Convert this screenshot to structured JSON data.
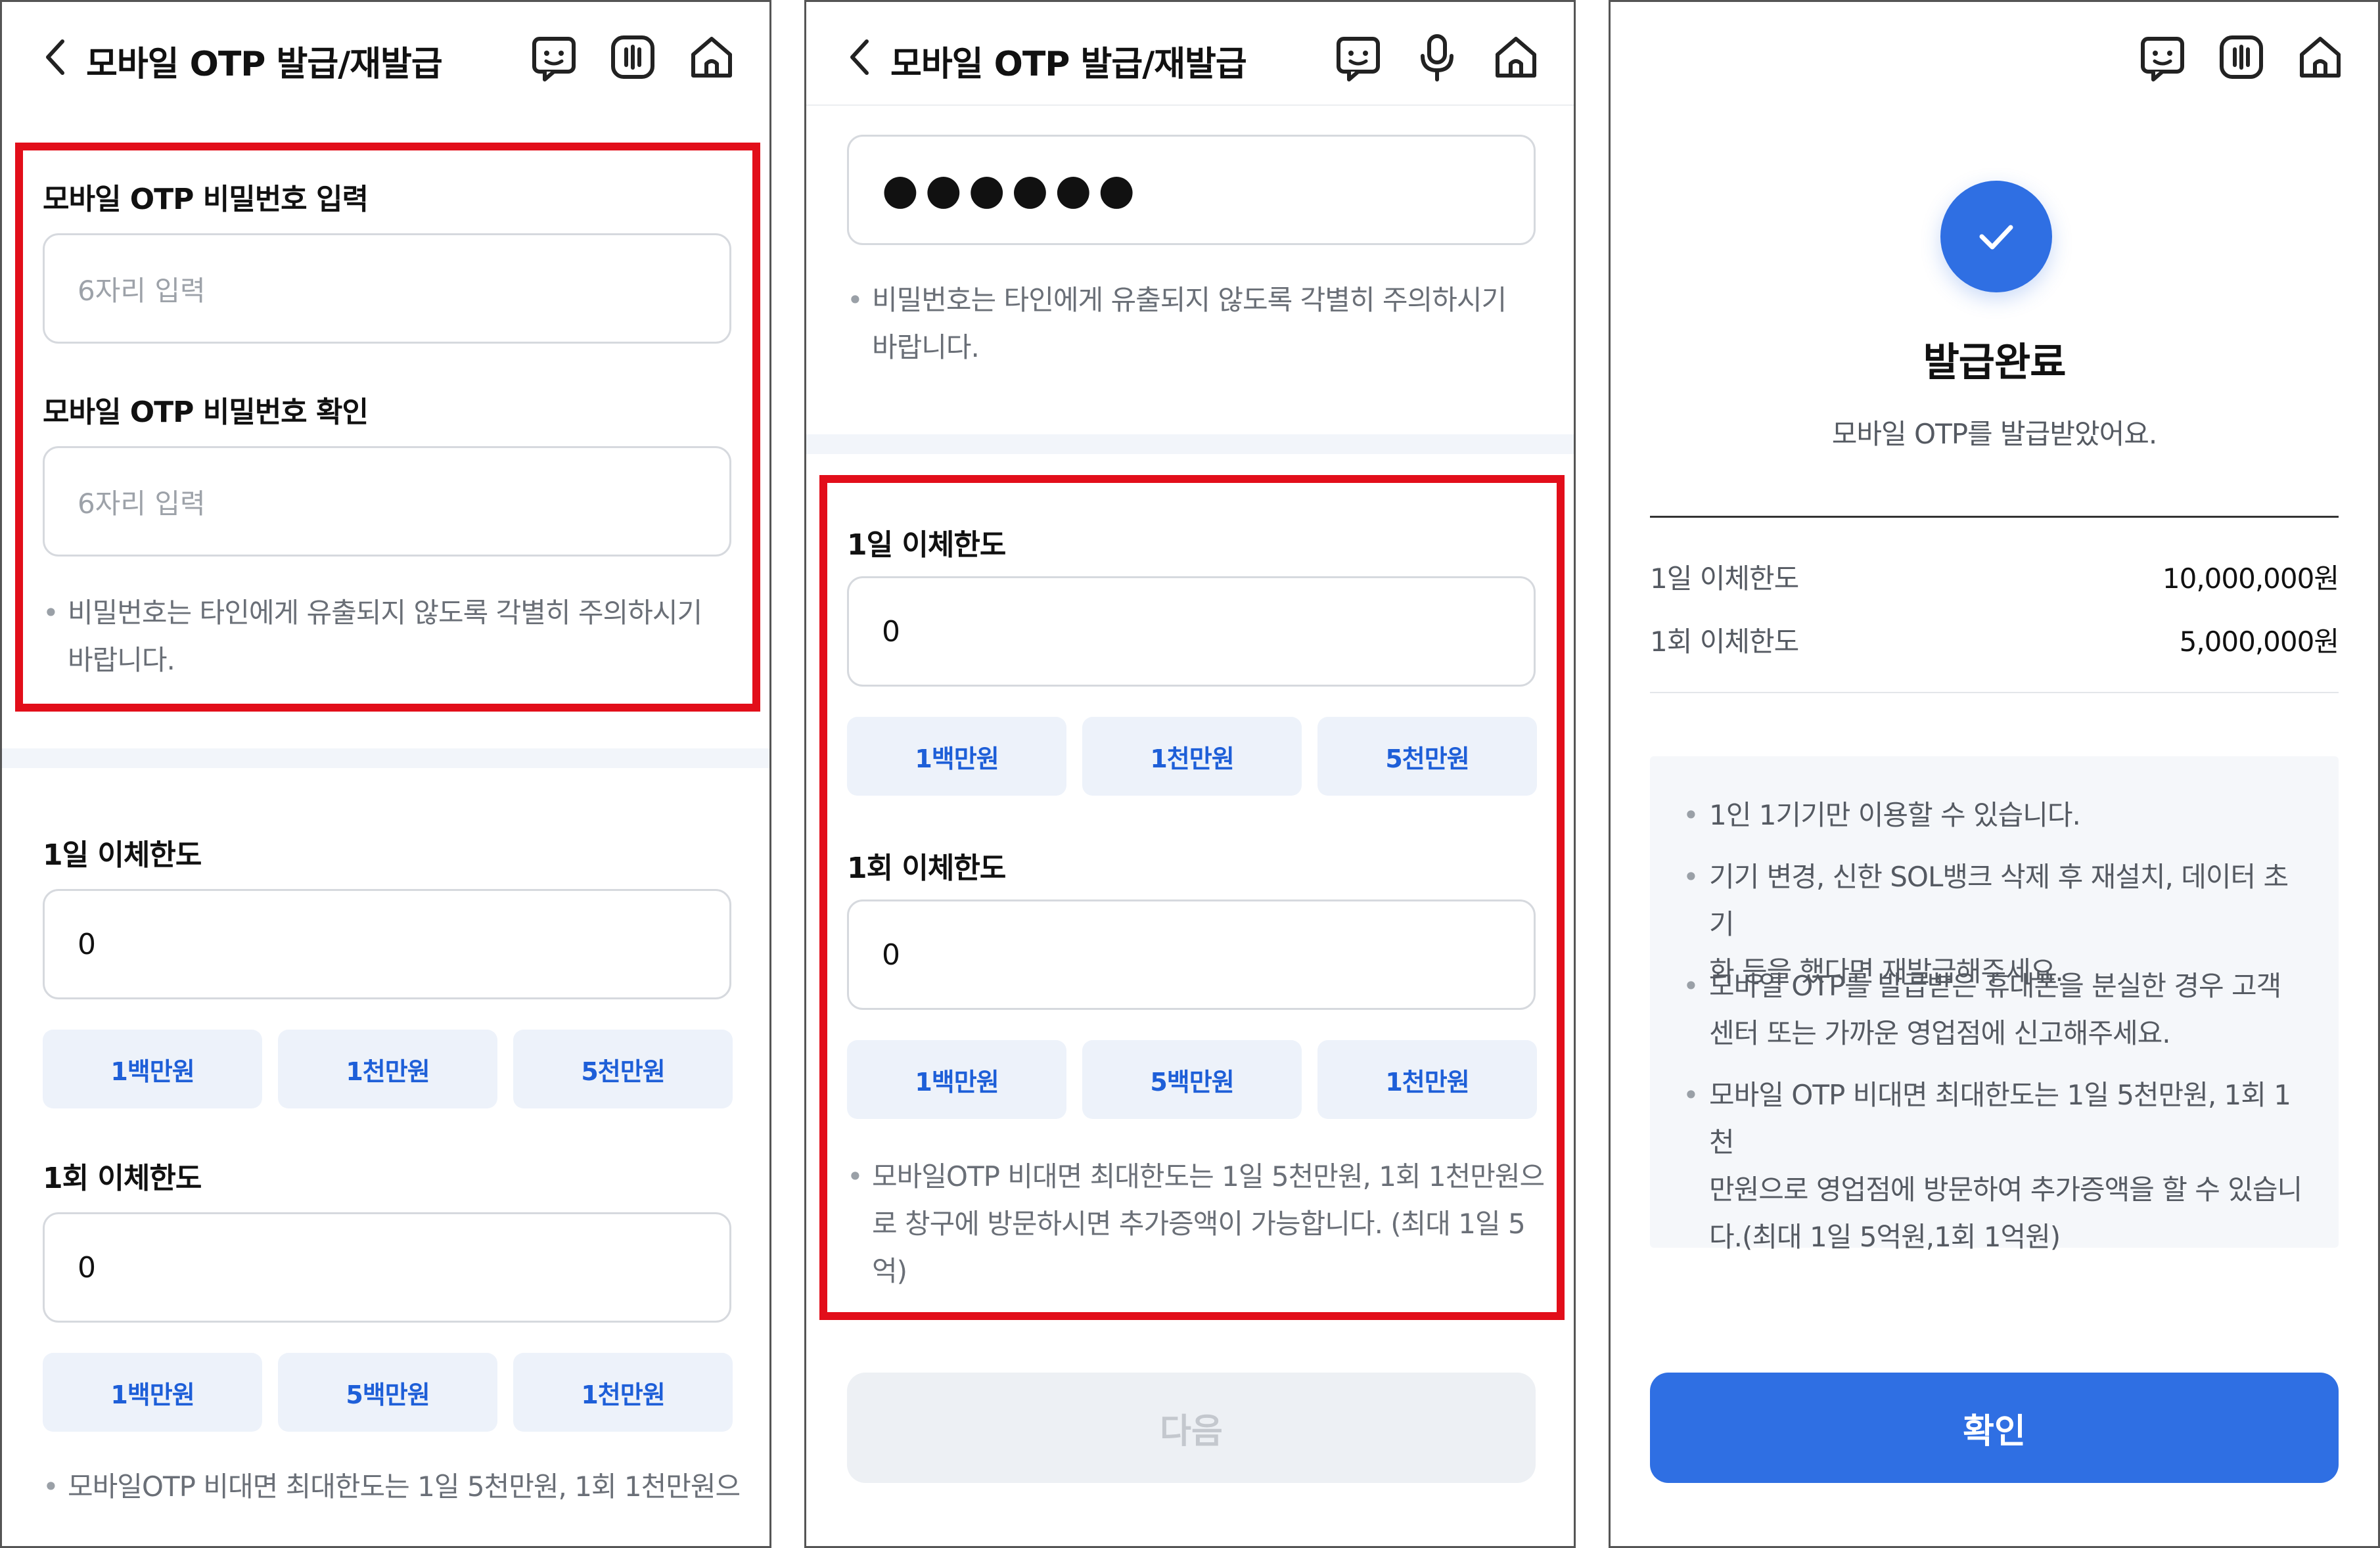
{
  "panel1": {
    "header": {
      "title": "모바일 OTP 발급/재발급"
    },
    "password": {
      "label": "모바일 OTP 비밀번호 입력",
      "placeholder": "6자리 입력",
      "confirm_label": "모바일 OTP 비밀번호 확인",
      "confirm_placeholder": "6자리 입력",
      "note_line1": "비밀번호는 타인에게 유출되지 않도록 각별히 주의하시기",
      "note_line2": "바랍니다."
    },
    "daily": {
      "label": "1일 이체한도",
      "value": "0",
      "chips": [
        "1백만원",
        "1천만원",
        "5천만원"
      ]
    },
    "per_tx": {
      "label": "1회 이체한도",
      "value": "0",
      "chips": [
        "1백만원",
        "5백만원",
        "1천만원"
      ]
    },
    "limit_note_line1": "모바일OTP 비대면 최대한도는 1일 5천만원, 1회 1천만원으"
  },
  "panel2": {
    "header": {
      "title": "모바일 OTP 발급/재발급"
    },
    "password_value": "●●●●●●",
    "note_line1": "비밀번호는 타인에게 유출되지 않도록 각별히 주의하시기",
    "note_line2": "바랍니다.",
    "daily": {
      "label": "1일 이체한도",
      "value": "0",
      "chips": [
        "1백만원",
        "1천만원",
        "5천만원"
      ]
    },
    "per_tx": {
      "label": "1회 이체한도",
      "value": "0",
      "chips": [
        "1백만원",
        "5백만원",
        "1천만원"
      ]
    },
    "limit_note_line1": "모바일OTP 비대면 최대한도는 1일 5천만원, 1회 1천만원으",
    "limit_note_line2": "로 창구에 방문하시면 추가증액이 가능합니다. (최대 1일 5",
    "limit_note_line3": "억)",
    "next_button": "다음"
  },
  "panel3": {
    "title": "발급완료",
    "subtitle": "모바일 OTP를 발급받았어요.",
    "summary": [
      {
        "key": "1일 이체한도",
        "value": "10,000,000원"
      },
      {
        "key": "1회 이체한도",
        "value": "5,000,000원"
      }
    ],
    "notices": [
      {
        "l1": "1인 1기기만 이용할 수 있습니다."
      },
      {
        "l1": "기기 변경, 신한 SOL뱅크 삭제 후 재설치, 데이터 초기",
        "l2": "화 등을 했다면 재발급해주세요."
      },
      {
        "l1": "모바일 OTP를 발급받은 휴대폰을 분실한 경우 고객",
        "l2": "센터 또는 가까운 영업점에 신고해주세요."
      },
      {
        "l1": "모바일 OTP 비대면 최대한도는 1일 5천만원, 1회 1천",
        "l2": "만원으로 영업점에 방문하여 추가증액을 할 수 있습니",
        "l3": "다.(최대 1일 5억원,1회 1억원)"
      }
    ],
    "confirm_button": "확인"
  },
  "icons": [
    "back-icon",
    "chatbot-icon",
    "voice-bars-icon",
    "microphone-icon",
    "home-icon",
    "check-icon"
  ],
  "colors": {
    "accent": "#2f6fe3",
    "chip_bg": "#edf2fa",
    "chip_text": "#1e5fd8",
    "highlight": "#e20e1a"
  }
}
